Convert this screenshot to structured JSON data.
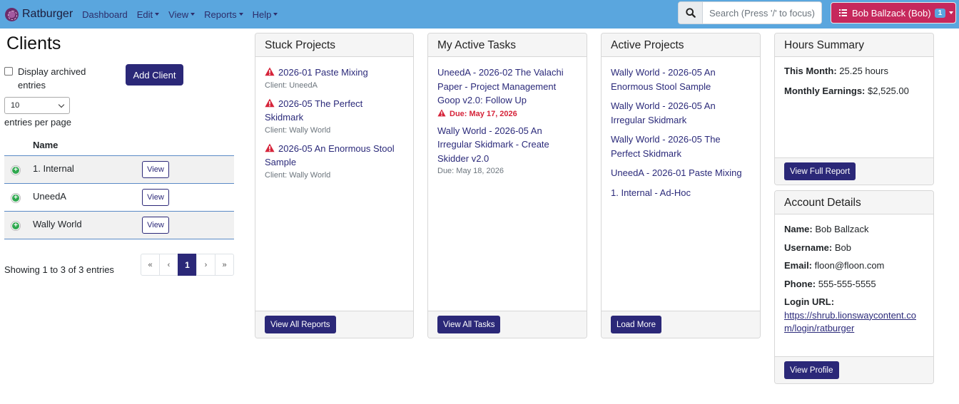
{
  "navbar": {
    "brand": "Ratburger",
    "menu": [
      "Dashboard",
      "Edit",
      "View",
      "Reports",
      "Help"
    ],
    "search_placeholder": "Search (Press '/' to focus)",
    "user_label": "Bob Ballzack (Bob)",
    "user_badge": "1"
  },
  "clients": {
    "title": "Clients",
    "archived_label": "Display archived entries",
    "add_label": "Add Client",
    "per_page_value": "10",
    "per_page_label": "entries per page",
    "column_name": "Name",
    "rows": [
      {
        "name": "1. Internal",
        "action": "View"
      },
      {
        "name": "UneedA",
        "action": "View"
      },
      {
        "name": "Wally World",
        "action": "View"
      }
    ],
    "showing": "Showing 1 to 3 of 3 entries",
    "pager": [
      "«",
      "‹",
      "1",
      "›",
      "»"
    ]
  },
  "stuck": {
    "title": "Stuck Projects",
    "items": [
      {
        "name": "2026-01 Paste Mixing",
        "client": "Client: UneedA"
      },
      {
        "name": "2026-05 The Perfect Skidmark",
        "client": "Client: Wally World"
      },
      {
        "name": "2026-05 An Enormous Stool Sample",
        "client": "Client: Wally World"
      }
    ],
    "footer_btn": "View All Reports"
  },
  "tasks": {
    "title": "My Active Tasks",
    "items": [
      {
        "name": "UneedA - 2026-02 The Valachi Paper - Project Management Goop v2.0: Follow Up",
        "due": "Due: May 17, 2026"
      },
      {
        "name": "Wally World - 2026-05 An Irregular Skidmark - Create Skidder v2.0",
        "due": "Due: May 18, 2026"
      }
    ],
    "footer_btn": "View All Tasks"
  },
  "active": {
    "title": "Active Projects",
    "items": [
      "Wally World - 2026-05 An Enormous Stool Sample",
      "Wally World - 2026-05 An Irregular Skidmark",
      "Wally World - 2026-05 The Perfect Skidmark",
      "UneedA - 2026-01 Paste Mixing",
      "1. Internal - Ad-Hoc"
    ],
    "footer_btn": "Load More"
  },
  "hours": {
    "title": "Hours Summary",
    "month_label": "This Month:",
    "month_value": "25.25 hours",
    "earn_label": "Monthly Earnings:",
    "earn_value": "$2,525.00",
    "footer_btn": "View Full Report"
  },
  "account": {
    "title": "Account Details",
    "name_label": "Name:",
    "name_value": "Bob Ballzack",
    "username_label": "Username:",
    "username_value": "Bob",
    "email_label": "Email:",
    "email_value": "floon@floon.com",
    "phone_label": "Phone:",
    "phone_value": "555-555-5555",
    "url_label": "Login URL:",
    "url_value": "https://shrub.lionswaycontent.com/login/ratburger",
    "footer_btn": "View Profile"
  },
  "colors": {
    "navbar": "#5aa6de",
    "primary": "#2b2878",
    "user_button": "#c6285c",
    "warning": "#d6243a"
  }
}
